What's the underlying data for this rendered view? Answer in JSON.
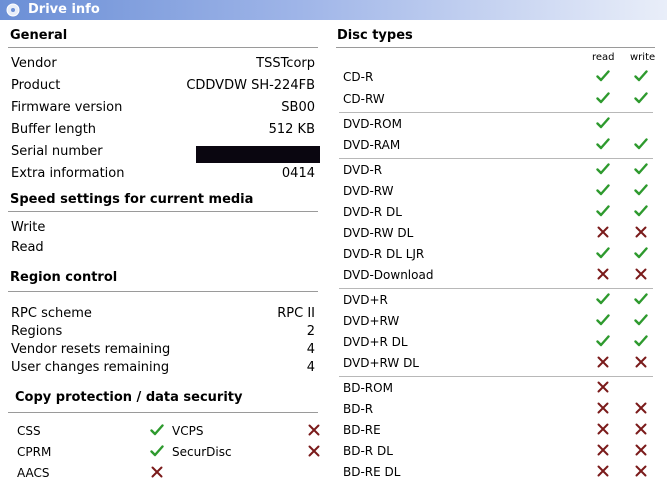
{
  "window": {
    "title": "Drive info"
  },
  "general": {
    "heading": "General",
    "rows": [
      {
        "label": "Vendor",
        "value": "TSSTcorp"
      },
      {
        "label": "Product",
        "value": "CDDVDW SH-224FB"
      },
      {
        "label": "Firmware version",
        "value": "SB00"
      },
      {
        "label": "Buffer length",
        "value": "512 KB"
      },
      {
        "label": "Serial number",
        "value": ""
      },
      {
        "label": "Extra information",
        "value": "0414"
      }
    ]
  },
  "speed": {
    "heading": "Speed settings for current media",
    "rows": [
      {
        "label": "Write"
      },
      {
        "label": "Read"
      }
    ]
  },
  "region": {
    "heading": "Region control",
    "rows": [
      {
        "label": "RPC scheme",
        "value": "RPC II"
      },
      {
        "label": "Regions",
        "value": "2"
      },
      {
        "label": "Vendor resets remaining",
        "value": "4"
      },
      {
        "label": "User changes remaining",
        "value": "4"
      }
    ]
  },
  "copy": {
    "heading": "Copy protection / data security",
    "items": [
      {
        "label": "CSS",
        "supported": true
      },
      {
        "label": "VCPS",
        "supported": false
      },
      {
        "label": "CPRM",
        "supported": true
      },
      {
        "label": "SecurDisc",
        "supported": false
      },
      {
        "label": "AACS",
        "supported": false
      }
    ]
  },
  "disc": {
    "heading": "Disc types",
    "read_label": "read",
    "write_label": "write",
    "rows": [
      {
        "name": "CD-R",
        "read": true,
        "write": true
      },
      {
        "name": "CD-RW",
        "read": true,
        "write": true
      },
      {
        "name": "DVD-ROM",
        "read": true,
        "write": null
      },
      {
        "name": "DVD-RAM",
        "read": true,
        "write": true
      },
      {
        "name": "DVD-R",
        "read": true,
        "write": true
      },
      {
        "name": "DVD-RW",
        "read": true,
        "write": true
      },
      {
        "name": "DVD-R DL",
        "read": true,
        "write": true
      },
      {
        "name": "DVD-RW DL",
        "read": false,
        "write": false
      },
      {
        "name": "DVD-R DL LJR",
        "read": true,
        "write": true
      },
      {
        "name": "DVD-Download",
        "read": false,
        "write": false
      },
      {
        "name": "DVD+R",
        "read": true,
        "write": true
      },
      {
        "name": "DVD+RW",
        "read": true,
        "write": true
      },
      {
        "name": "DVD+R DL",
        "read": true,
        "write": true
      },
      {
        "name": "DVD+RW DL",
        "read": false,
        "write": false
      },
      {
        "name": "BD-ROM",
        "read": false,
        "write": null
      },
      {
        "name": "BD-R",
        "read": false,
        "write": false
      },
      {
        "name": "BD-RE",
        "read": false,
        "write": false
      },
      {
        "name": "BD-R DL",
        "read": false,
        "write": false
      },
      {
        "name": "BD-RE DL",
        "read": false,
        "write": false
      }
    ]
  },
  "colors": {
    "check": "#2e9a2e",
    "cross": "#7a1a1a",
    "title_bar": "#6b8fd6"
  }
}
